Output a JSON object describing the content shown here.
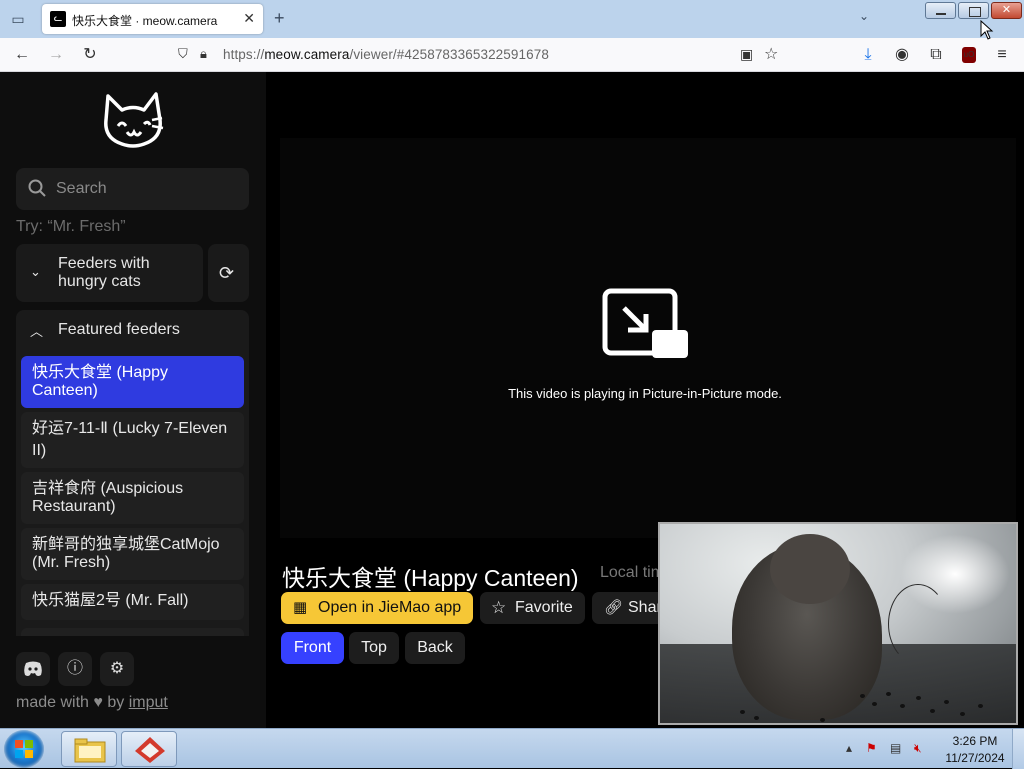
{
  "browser": {
    "tab": {
      "title": "快乐大食堂 · meow.camera",
      "close": "✕"
    },
    "new_tab": "+",
    "url": {
      "scheme": "https://",
      "host": "meow.camera",
      "path": "/viewer/#4258783365322591678"
    }
  },
  "sidebar": {
    "search_placeholder": "Search",
    "try_hint": "Try: “Mr. Fresh”",
    "hungry_label": "Feeders with hungry cats",
    "featured_label": "Featured feeders",
    "feeders": [
      {
        "label": "快乐大食堂 (Happy Canteen)",
        "active": true
      },
      {
        "label": "好运7-11-Ⅱ (Lucky 7-Eleven II)",
        "active": false
      },
      {
        "label": "吉祥食府 (Auspicious Restaurant)",
        "active": false
      },
      {
        "label": "新鲜哥的独享城堡CatMojo (Mr. Fresh)",
        "active": false
      },
      {
        "label": "快乐猫屋2号 (Mr. Fall)",
        "active": false
      }
    ],
    "footer": {
      "made_with": "made with",
      "by": "by",
      "author": "imput"
    }
  },
  "main": {
    "pip_message": "This video is playing in Picture-in-Picture mode.",
    "title": "快乐大食堂 (Happy Canteen)",
    "local_time_label": "Local time",
    "buttons": {
      "open_app": "Open in JieMao app",
      "favorite": "Favorite",
      "share": "Share"
    },
    "views": [
      "Front",
      "Top",
      "Back"
    ],
    "active_view": "Front"
  },
  "taskbar": {
    "time": "3:26 PM",
    "date": "11/27/2024"
  },
  "colors": {
    "accent_blue": "#3641ff",
    "active_feeder": "#2f3be0",
    "open_app_yellow": "#f6c736"
  }
}
